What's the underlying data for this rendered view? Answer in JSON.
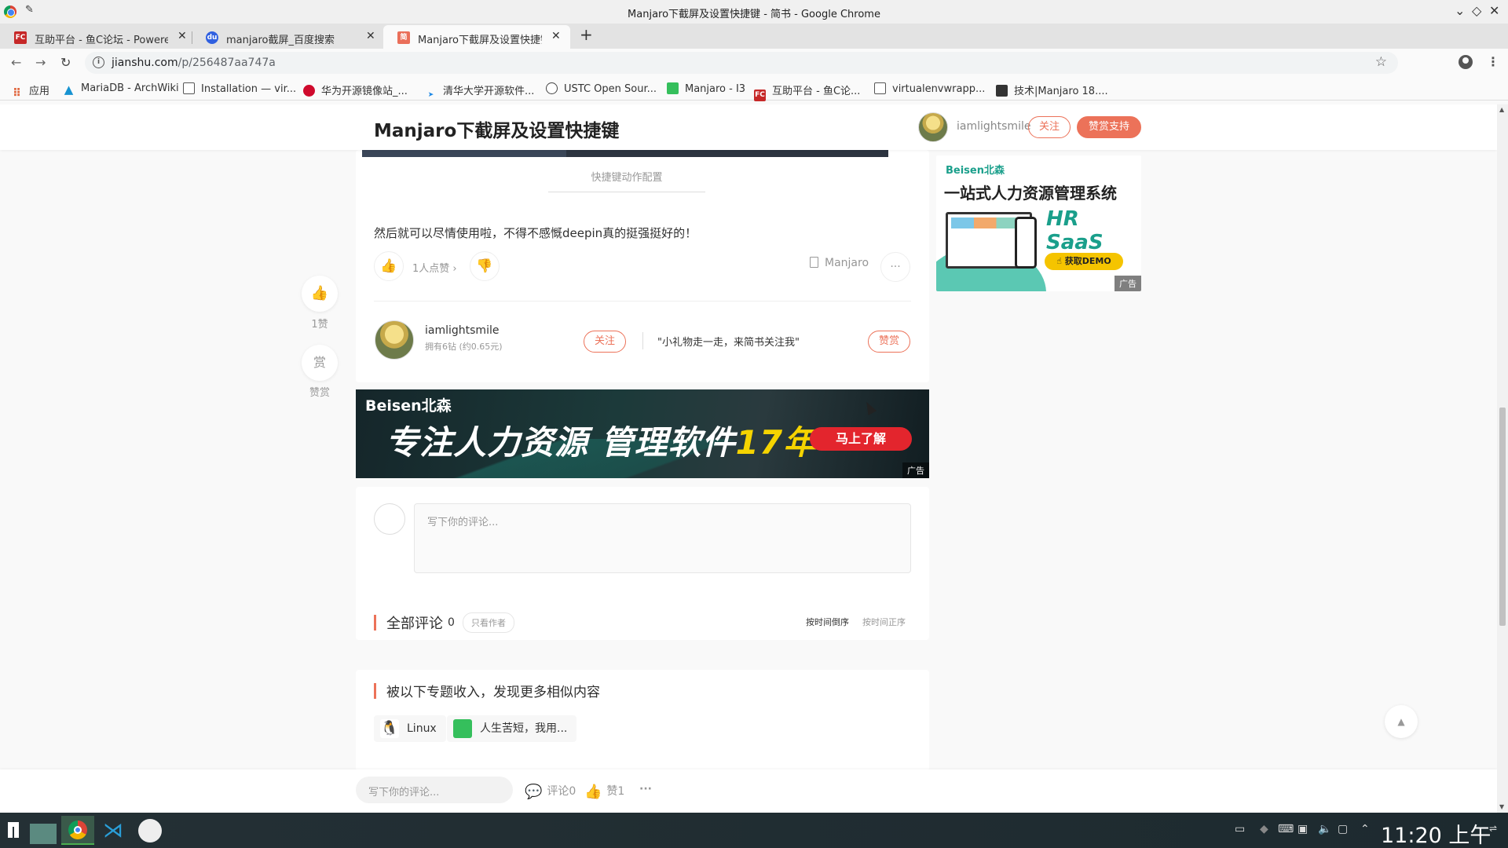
{
  "window": {
    "title": "Manjaro下截屏及设置快捷键 - 简书 - Google Chrome"
  },
  "tabs": [
    {
      "label": "互助平台 - 鱼C论坛 - Powered",
      "favicon": "FC",
      "color": "#c62828"
    },
    {
      "label": "manjaro截屏_百度搜索",
      "favicon": "du",
      "color": "#3060e0"
    },
    {
      "label": "Manjaro下截屏及设置快捷键",
      "favicon": "简",
      "color": "#ea6f5a"
    }
  ],
  "omnibox": {
    "host": "jianshu.com",
    "path": "/p/256487aa747a"
  },
  "bookmarks": [
    {
      "label": "应用",
      "icon": "apps-grid-icon",
      "color": "#e0663e"
    },
    {
      "label": "MariaDB - ArchWiki",
      "icon": "arch-icon",
      "color": "#1793d1"
    },
    {
      "label": "Installation — vir...",
      "icon": "doc-icon",
      "color": "#555555"
    },
    {
      "label": "华为开源镜像站_...",
      "icon": "huawei-icon",
      "color": "#cf0a2c"
    },
    {
      "label": "清华大学开源软件...",
      "icon": "tuna-icon",
      "color": "#1e88e5"
    },
    {
      "label": "USTC Open Sour...",
      "icon": "ustc-icon",
      "color": "#444444"
    },
    {
      "label": "Manjaro - I3",
      "icon": "manjaro-icon",
      "color": "#35bf5c"
    },
    {
      "label": "互助平台 - 鱼C论...",
      "icon": "fishc-icon",
      "color": "#c62828"
    },
    {
      "label": "virtualenvwrapp...",
      "icon": "doc-icon",
      "color": "#555555"
    },
    {
      "label": "技术|Manjaro 18....",
      "icon": "linuxcn-icon",
      "color": "#333333"
    }
  ],
  "header": {
    "title": "Manjaro下截屏及设置快捷键",
    "author": "iamlightsmile",
    "follow": "关注",
    "reward": "赞赏支持"
  },
  "rail": {
    "likes": "1赞",
    "reward_icon": "赏",
    "reward_label": "赞赏"
  },
  "article": {
    "caption": "快捷键动作配置",
    "paragraph": "然后就可以尽情使用啦，不得不感慨deepin真的挺强挺好的！",
    "like_count": "1人点赞",
    "notebook": "Manjaro"
  },
  "author_card": {
    "name": "iamlightsmile",
    "meta": "拥有6钻 (约0.65元)",
    "follow": "关注",
    "quote": "\"小礼物走一走，来简书关注我\"",
    "reward": "赞赏"
  },
  "banner_ad": {
    "brand": "Beisen北森",
    "slogan_main": "专注人力资源 管理软件",
    "slogan_year": "17年",
    "cta": "马上了解",
    "tag": "广告"
  },
  "side_ad": {
    "brand": "Beisen北森",
    "headline": "一站式人力资源管理系统",
    "product": "HR SaaS",
    "cta": "获取DEMO",
    "tag": "广告"
  },
  "comments": {
    "placeholder": "写下你的评论...",
    "section_title": "全部评论",
    "count": "0",
    "only_author": "只看作者",
    "sort_desc": "按时间倒序",
    "sort_asc": "按时间正序"
  },
  "collections": {
    "title": "被以下专题收入，发现更多相似内容",
    "items": [
      "Linux",
      "人生苦短，我用..."
    ]
  },
  "bottom_bar": {
    "placeholder": "写下你的评论...",
    "comments": "评论0",
    "likes": "赞1"
  },
  "taskbar": {
    "clock": "11:20 上午"
  },
  "colors": {
    "accent": "#ec7259",
    "chrome_tab": "#fafafa"
  }
}
